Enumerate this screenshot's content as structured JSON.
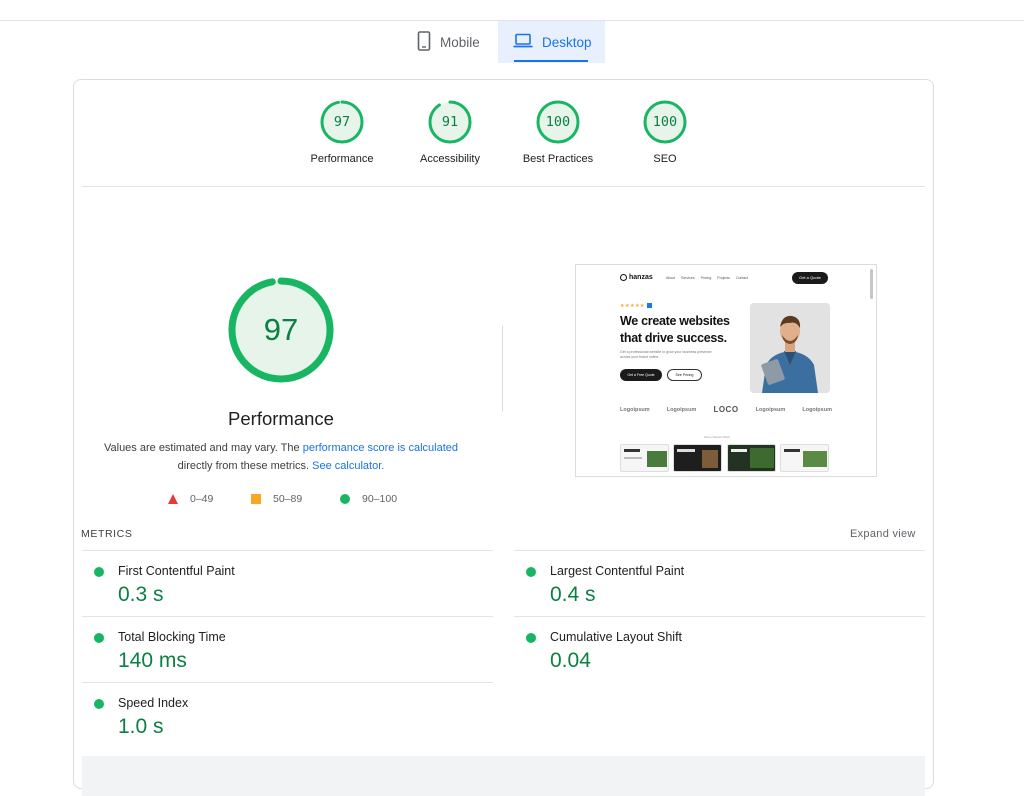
{
  "tabs": {
    "mobile": {
      "label": "Mobile",
      "icon": "phone-icon",
      "active": false
    },
    "desktop": {
      "label": "Desktop",
      "icon": "laptop-icon",
      "active": true
    }
  },
  "summary_scores": [
    {
      "category": "Performance",
      "score": "97"
    },
    {
      "category": "Accessibility",
      "score": "91"
    },
    {
      "category": "Best Practices",
      "score": "100"
    },
    {
      "category": "SEO",
      "score": "100"
    }
  ],
  "performance": {
    "score": "97",
    "score_value": 97,
    "title": "Performance",
    "desc_prefix": "Values are estimated and may vary. The ",
    "desc_link1": "performance score is calculated",
    "desc_middle": " directly from these metrics. ",
    "desc_link2": "See calculator."
  },
  "legend": [
    {
      "range": "0–49",
      "shape": "triangle",
      "color": "#e53935"
    },
    {
      "range": "50–89",
      "shape": "square",
      "color": "#f8a623"
    },
    {
      "range": "90–100",
      "shape": "circle",
      "color": "#18b663"
    }
  ],
  "thumbnail": {
    "brand": "hanzas",
    "nav": [
      "About",
      "Services",
      "Pricing",
      "Projects",
      "Contact"
    ],
    "cta": "Get a Quote",
    "stars": "★★★★★",
    "headline": "We create websites that drive success.",
    "sub": "Get a professional website to grow your business presence across your brand online.",
    "btn_primary": "Get a Free Quote",
    "btn_secondary": "See Pricing",
    "logos": [
      "Logoipsum",
      "Logoipsum",
      "LOCO",
      "Logoipsum",
      "Logoipsum"
    ],
    "cards_label": "Some Recent Work"
  },
  "metrics": {
    "title": "METRICS",
    "expand_label": "Expand view",
    "items": [
      {
        "name": "First Contentful Paint",
        "value": "0.3 s",
        "status": "good"
      },
      {
        "name": "Largest Contentful Paint",
        "value": "0.4 s",
        "status": "good"
      },
      {
        "name": "Total Blocking Time",
        "value": "140 ms",
        "status": "good"
      },
      {
        "name": "Cumulative Layout Shift",
        "value": "0.04",
        "status": "good"
      },
      {
        "name": "Speed Index",
        "value": "1.0 s",
        "status": "good"
      }
    ]
  },
  "colors": {
    "pass": "#0b8043",
    "pass_fill": "#e6f4ea",
    "pass_ring": "#18b663",
    "accent": "#1a73e8"
  }
}
